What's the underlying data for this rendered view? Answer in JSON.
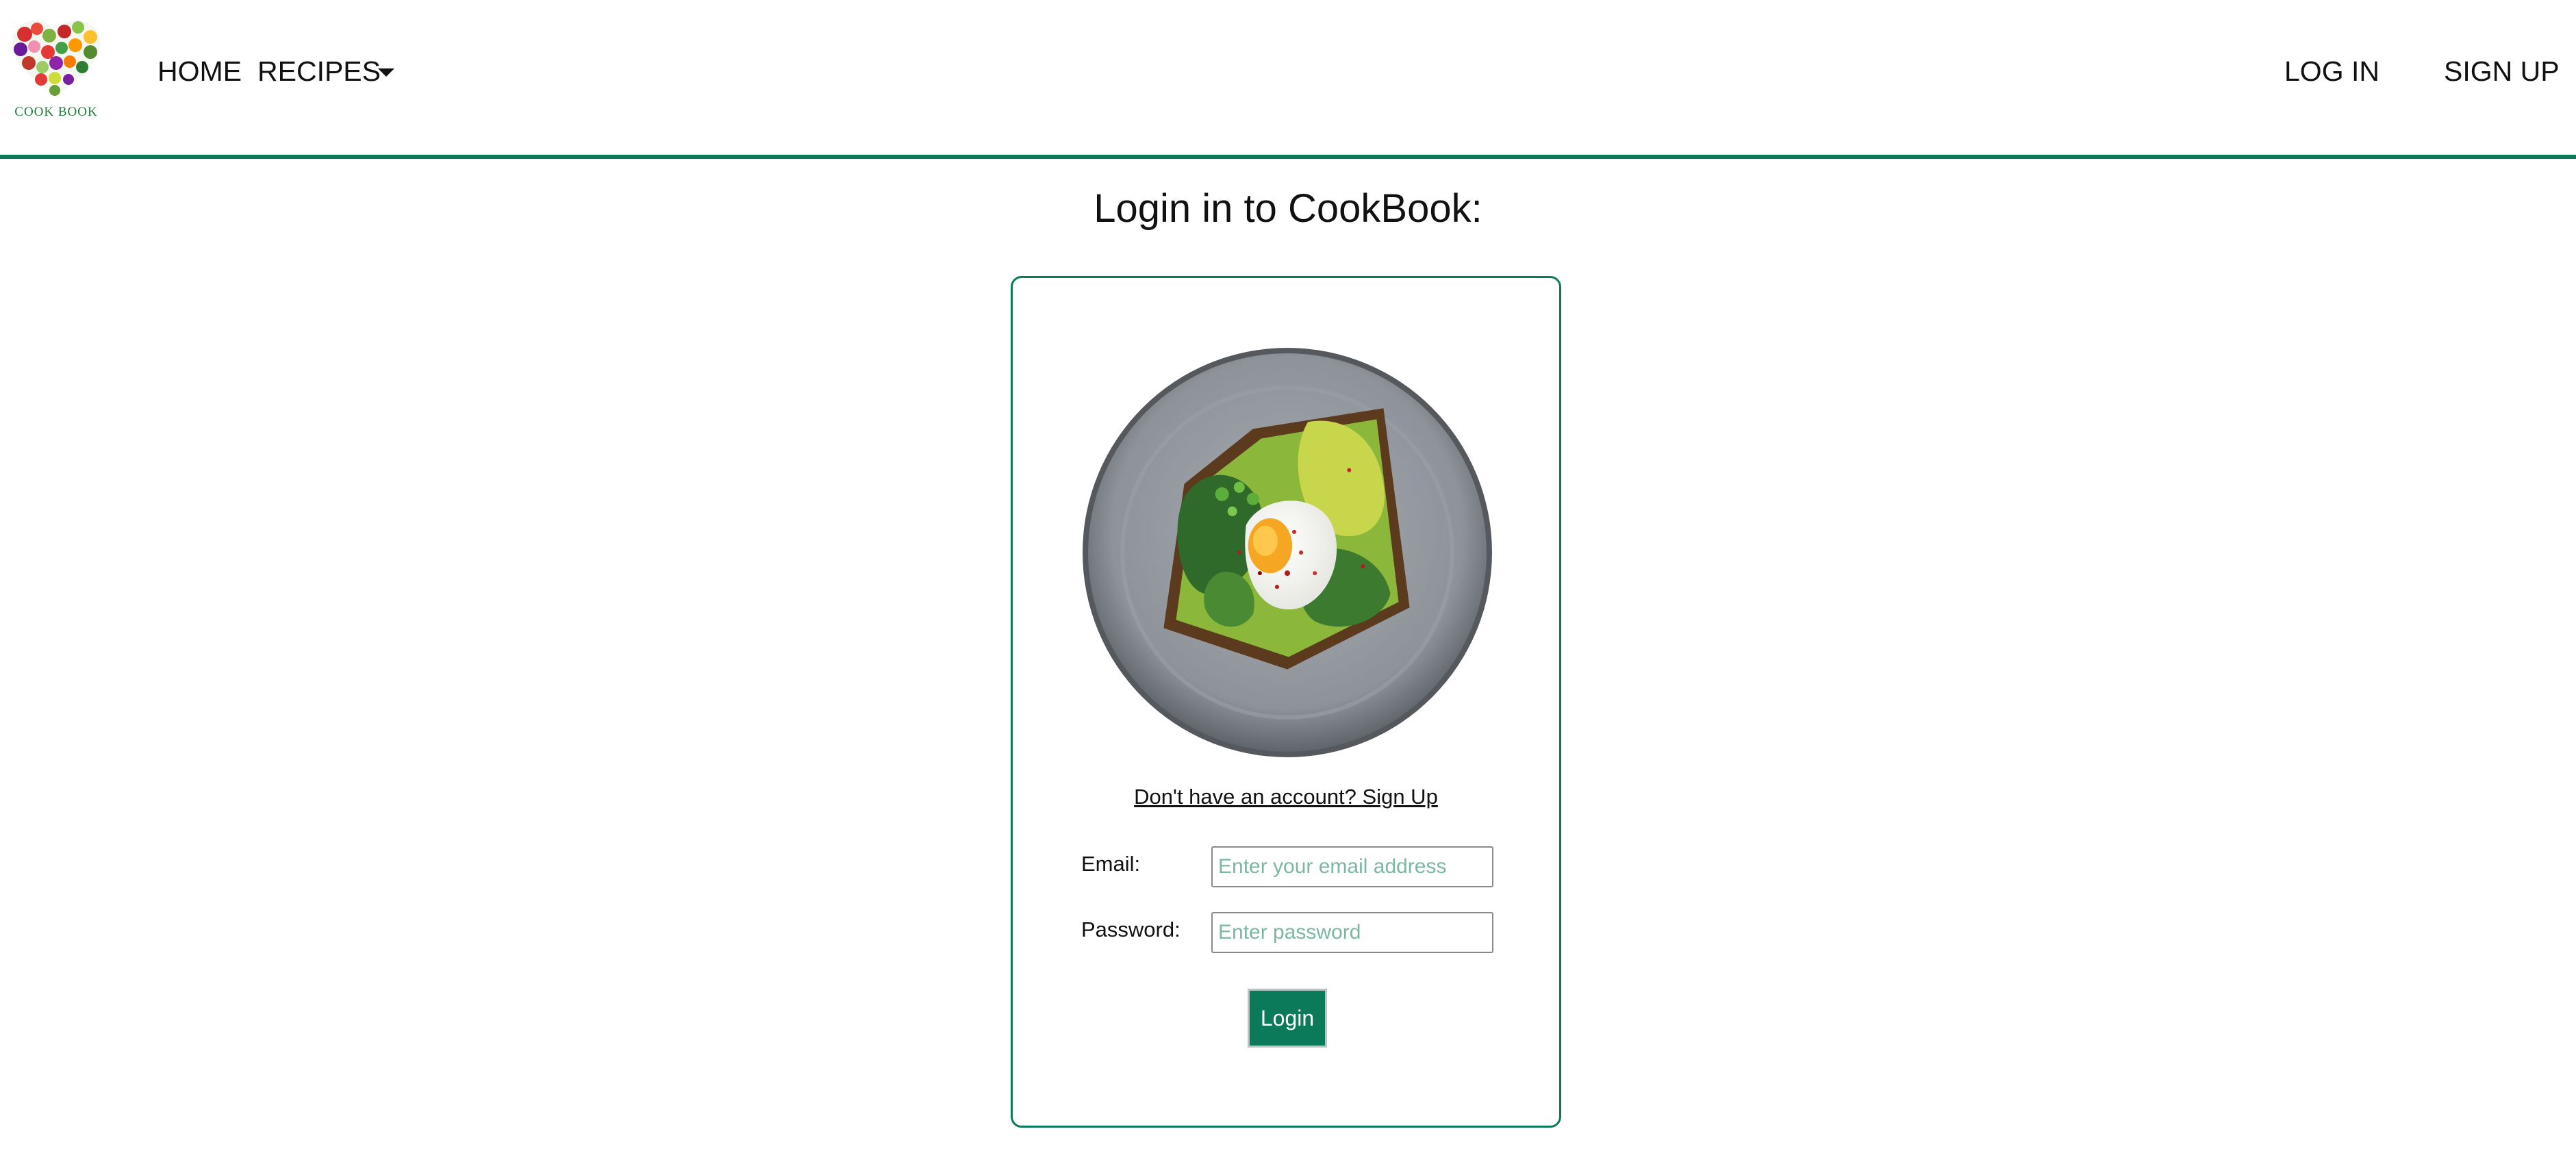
{
  "brand": {
    "logo_text": "COOK BOOK"
  },
  "nav": {
    "home_label": "HOME",
    "recipes_label": "RECIPES",
    "login_label": "LOG IN",
    "signup_label": "SIGN UP"
  },
  "page": {
    "title": "Login in to CookBook:"
  },
  "login_form": {
    "signup_link": "Don't have an account? Sign Up",
    "email_label": "Email:",
    "email_placeholder": "Enter your email address",
    "email_value": "",
    "password_label": "Password:",
    "password_placeholder": "Enter password",
    "password_value": "",
    "submit_label": "Login"
  },
  "colors": {
    "accent": "#0a7a5a",
    "placeholder": "#7ab8a2"
  },
  "icons": {
    "logo": "heart-of-vegetables-icon",
    "dropdown": "caret-down-icon"
  }
}
